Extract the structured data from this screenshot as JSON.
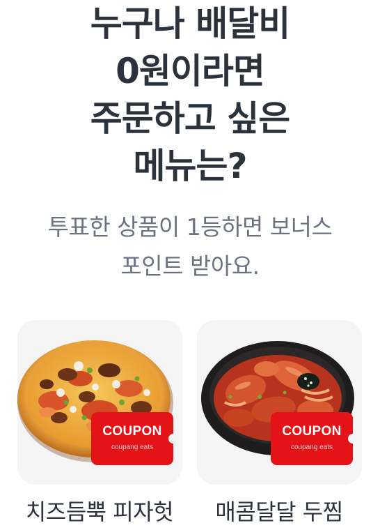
{
  "headline": {
    "lines": [
      "누구나 배달비",
      "0원이라면",
      "주문하고 싶은",
      "메뉴는?"
    ]
  },
  "subtitle": {
    "lines": [
      "투표한 상품이 1등하면 보너스",
      "포인트 받아요."
    ]
  },
  "options": [
    {
      "name": "치즈듬뿍 피자헛",
      "image": "pizza",
      "coupon": {
        "title": "COUPON",
        "brand": "coupang eats"
      }
    },
    {
      "name": "매콤달달 두찜",
      "image": "braised-chicken",
      "coupon": {
        "title": "COUPON",
        "brand": "coupang eats"
      }
    }
  ],
  "colors": {
    "headline": "#2b323c",
    "subtitle": "#6b7380",
    "card_bg": "#f5f5f5",
    "coupon_red": "#e31318"
  }
}
